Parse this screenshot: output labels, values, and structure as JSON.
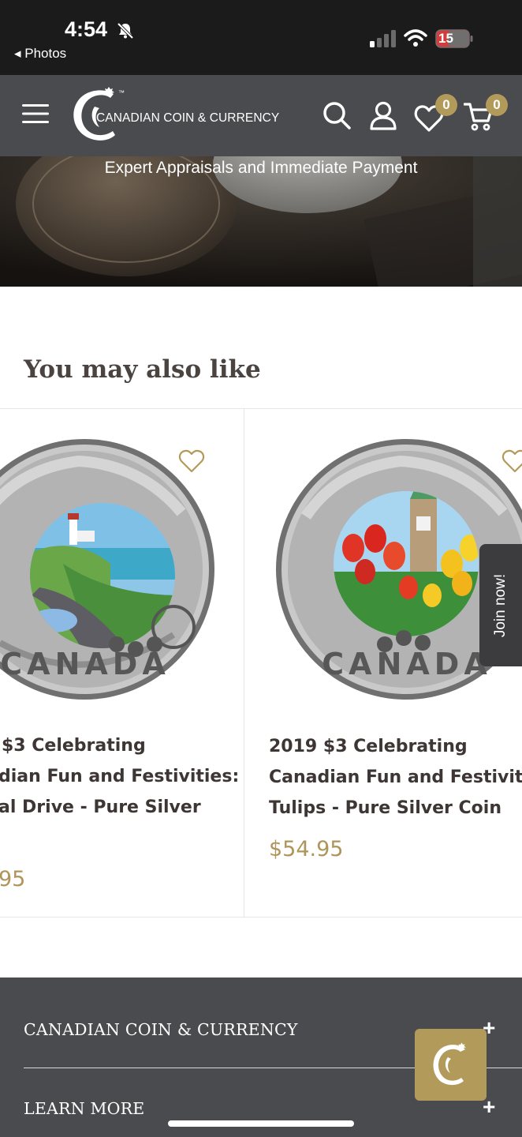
{
  "status_bar": {
    "time": "4:54",
    "back_label": "◂ Photos",
    "battery_level": "15"
  },
  "header": {
    "brand": "CANADIAN COIN & CURRENCY",
    "trademark": "™",
    "wishlist_count": "0",
    "cart_count": "0"
  },
  "hero": {
    "tagline": "Expert Appraisals and Immediate Payment"
  },
  "recommendations": {
    "title": "You may also like",
    "products": [
      {
        "title_lines": [
          "$3 Celebrating",
          "dian Fun and Festivities:",
          "al Drive - Pure Silver"
        ],
        "price": "95"
      },
      {
        "title_lines": [
          "2019 $3 Celebrating",
          "Canadian Fun and Festivities",
          "Tulips - Pure Silver Coin"
        ],
        "price": "$54.95"
      }
    ]
  },
  "join_tab": {
    "label": "Join now!"
  },
  "footer": {
    "sections": [
      "CANADIAN COIN & CURRENCY",
      "LEARN MORE"
    ],
    "expand_symbol": "+"
  },
  "colors": {
    "header_bg": "#4a4b4e",
    "accent_gold": "#b29a5a",
    "price_gold": "#b0955a",
    "status_bar_bg": "#1b1b1b"
  }
}
